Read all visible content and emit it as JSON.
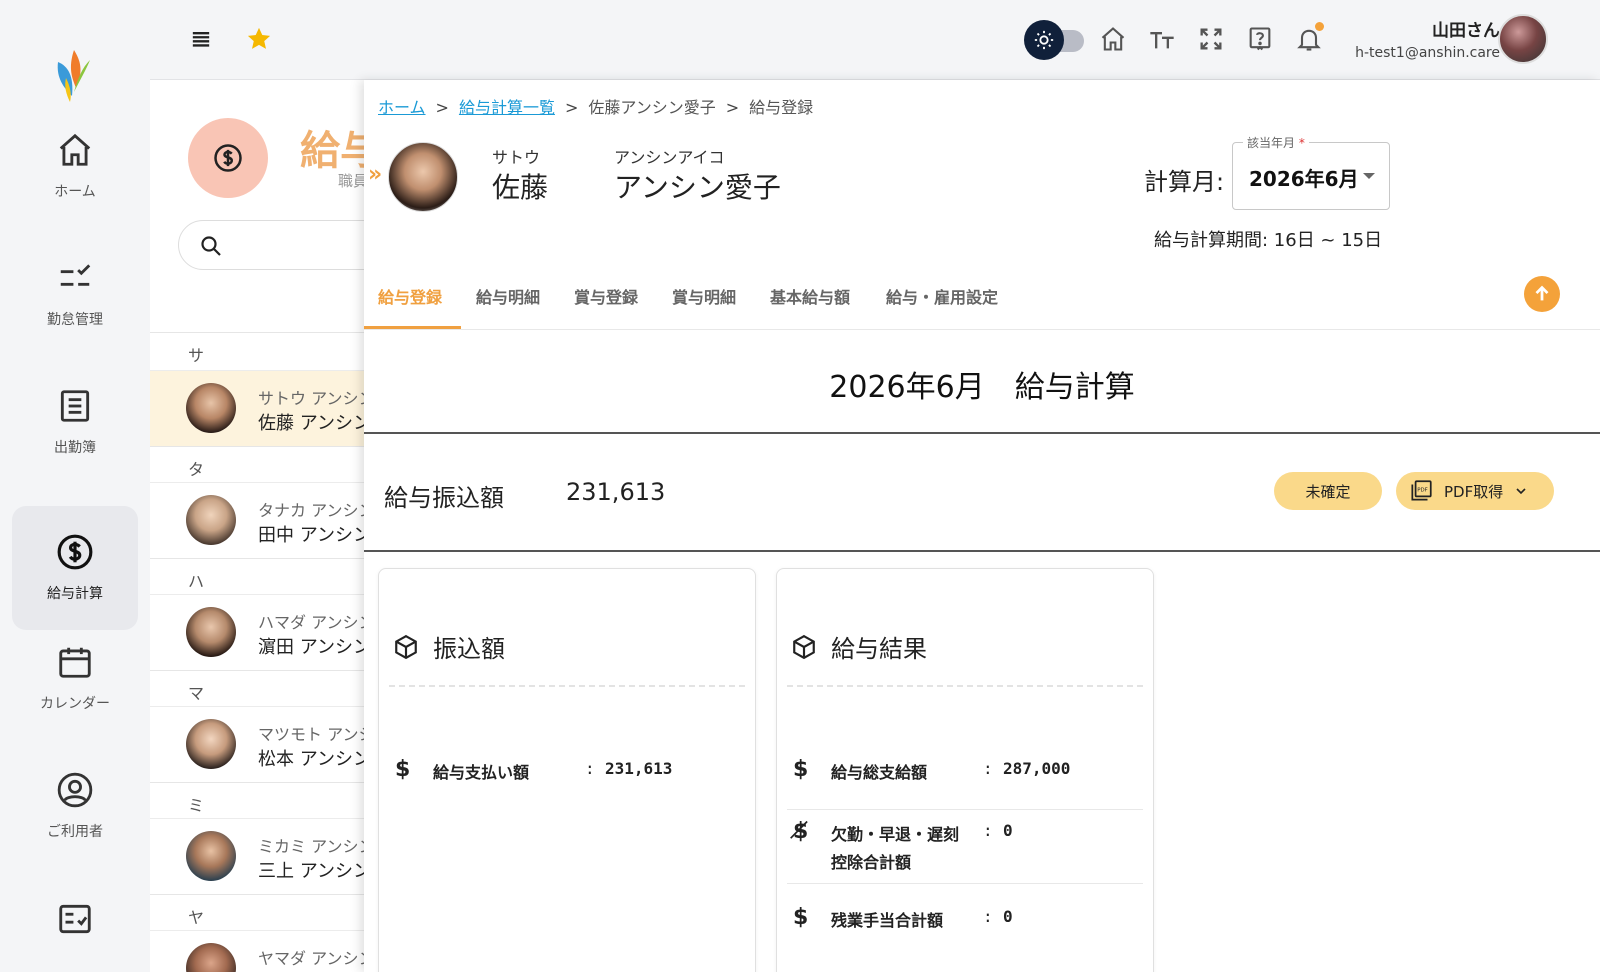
{
  "sidebar": {
    "items": [
      {
        "label": "ホーム",
        "icon": "home-icon"
      },
      {
        "label": "勤怠管理",
        "icon": "checklist-icon"
      },
      {
        "label": "出勤簿",
        "icon": "list-icon"
      },
      {
        "label": "給与計算",
        "icon": "dollar-icon"
      },
      {
        "label": "カレンダー",
        "icon": "calendar-icon"
      },
      {
        "label": "ご利用者",
        "icon": "user-icon"
      }
    ]
  },
  "topbar": {
    "user_name": "山田さん",
    "user_email": "h-test1@anshin.care",
    "accent": "#f4a23a"
  },
  "list": {
    "title": "給与",
    "subtitle": "職員",
    "groups": [
      {
        "head": "サ",
        "people": [
          {
            "kana": "サトウ アンシン",
            "name": "佐藤 アンシン"
          }
        ]
      },
      {
        "head": "タ",
        "people": [
          {
            "kana": "タナカ アンシン",
            "name": "田中 アンシン"
          }
        ]
      },
      {
        "head": "ハ",
        "people": [
          {
            "kana": "ハマダ アンシン",
            "name": "濵田 アンシン"
          }
        ]
      },
      {
        "head": "マ",
        "people": [
          {
            "kana": "マツモト アンシン",
            "name": "松本 アンシン"
          }
        ]
      },
      {
        "head": "ミ",
        "people": [
          {
            "kana": "ミカミ アンシン",
            "name": "三上 アンシン"
          }
        ]
      },
      {
        "head": "ヤ",
        "people": [
          {
            "kana": "ヤマダ アンシン",
            "name": ""
          }
        ]
      }
    ]
  },
  "breadcrumb": {
    "home": "ホーム",
    "list": "給与計算一覧",
    "employee": "佐藤アンシン愛子",
    "current": "給与登録",
    "sep": ">"
  },
  "employee": {
    "last_kana": "サトウ",
    "last_name": "佐藤",
    "first_kana": "アンシンアイコ",
    "first_name": "アンシン愛子"
  },
  "month_select": {
    "label": "計算月:",
    "legend": "該当年月",
    "required_mark": "*",
    "value": "2026年6月"
  },
  "period": "給与計算期間: 16日 ~ 15日",
  "tabs": [
    "給与登録",
    "給与明細",
    "賞与登録",
    "賞与明細",
    "基本給与額",
    "給与・雇用設定"
  ],
  "calc_title": "2026年6月　給与計算",
  "transfer": {
    "label": "給与振込額",
    "value": "231,613"
  },
  "status_badge": "未確定",
  "pdf_button": "PDF取得",
  "cards": {
    "transfer": {
      "title": "振込額",
      "rows": [
        {
          "icon": "$",
          "label": "給与支払い額",
          "value": "231,613"
        }
      ]
    },
    "result": {
      "title": "給与結果",
      "rows": [
        {
          "icon": "$",
          "label": "給与総支給額",
          "label2": "",
          "value": "287,000"
        },
        {
          "icon": "$̸",
          "label": "欠勤・早退・遅刻",
          "label2": "控除合計額",
          "value": "0"
        },
        {
          "icon": "$",
          "label": "残業手当合計額",
          "label2": "",
          "value": "0"
        }
      ]
    }
  },
  "colon": ":"
}
